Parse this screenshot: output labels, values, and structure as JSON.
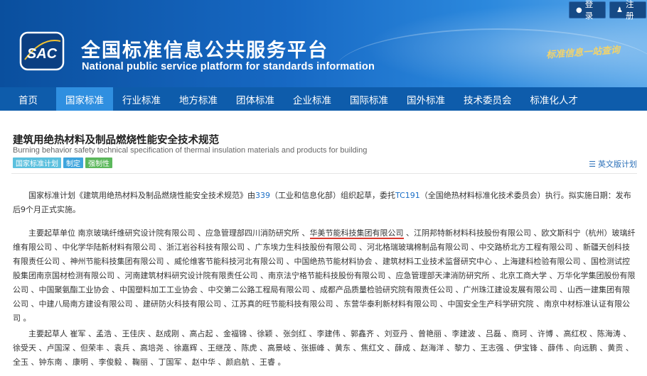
{
  "header": {
    "logo_text": "SAC",
    "title": "全国标准信息公共服务平台",
    "subtitle": "National public service platform  for standards information",
    "slogan": "标准信息一站查询",
    "login_label": "登录",
    "register_label": "注册"
  },
  "nav": {
    "items": [
      {
        "label": "首页"
      },
      {
        "label": "国家标准"
      },
      {
        "label": "行业标准"
      },
      {
        "label": "地方标准"
      },
      {
        "label": "团体标准"
      },
      {
        "label": "企业标准"
      },
      {
        "label": "国际标准"
      },
      {
        "label": "国外标准"
      },
      {
        "label": "技术委员会"
      },
      {
        "label": "标准化人才"
      }
    ],
    "active": "国家标准"
  },
  "standard": {
    "title": "建筑用绝热材料及制品燃烧性能安全技术规范",
    "title_en": "Burning behavior safety technical specification of thermal insulation materials and products for building",
    "badges": [
      "国家标准计划",
      "制定",
      "强制性"
    ],
    "english_version_label": "英文版计划"
  },
  "plan": {
    "p1": "国家标准计划《建筑用绝热材料及制品燃烧性能安全技术规范》由",
    "dept_code": "339",
    "p2": "（工业和信息化部）组织起草，委托",
    "tc_code": "TC191",
    "p3": "（全国绝热材料标准化技术委员会）执行。拟实施日期：发布后9个月正式实施。"
  },
  "units": {
    "label": "主要起草单位",
    "before": "南京玻璃纤维研究设计院有限公司 、应急管理部四川消防研究所 、",
    "highlighted": "华美节能科技集团有限公司",
    "after": " 、江阴邦特新材料科技股份有限公司 、欧文斯科宁（杭州）玻璃纤维有限公司 、中化学华陆新材料有限公司 、浙江岩谷科技有限公司 、广东埃力生科技股份有限公司 、河北格瑞玻璃棉制品有限公司 、中交路桥北方工程有限公司 、新疆天创科技有限责任公司 、神州节能科技集团有限公司 、威伦维客节能科技河北有限公司 、中国绝热节能材料协会 、建筑材料工业技术监督研究中心 、上海建科检验有限公司 、国检测试控股集团南京国材检测有限公司 、河南建筑材料研究设计院有限责任公司 、南京法宁格节能科技股份有限公司 、应急管理部天津消防研究所 、北京工商大学 、万华化学集团股份有限公司 、中国聚氨酯工业协会 、中国塑料加工工业协会 、中交第二公路工程局有限公司 、成都产品质量检验研究院有限责任公司 、广州珠江建设发展有限公司 、山西一建集团有限公司 、中建八局南方建设有限公司 、建研防火科技有限公司 、江苏真的旺节能科技有限公司 、东营华泰利新材料有限公司 、中国安全生产科学研究院 、南京中材标准认证有限公司 。"
  },
  "people": {
    "label": "主要起草人",
    "text": "崔军 、孟浩 、王佳庆 、赵成刚 、高占起 、金福锦 、徐颖 、张剑红 、李建伟 、郭鑫齐 、刘亚丹 、曾艳丽 、李建波 、吕磊 、商珂 、许博 、高红权 、陈海涛 、徐受天 、卢国深 、但荣丰 、袁兵 、高培尧 、徐嘉辉 、王继茂 、陈虎 、高景岐 、张振峰 、黄东 、焦红文 、薛成 、赵海洋 、黎力 、王志强 、伊宝锋 、薛伟 、向远鹏 、黄贡 、全玉 、钟东南 、康明 、李俊毅 、鞠丽 、丁国军 、赵中华 、颜启航 、王睿 。"
  },
  "colors": {
    "header_blue": "#0a4f9e",
    "nav_blue": "#0e5cab",
    "nav_active": "#2f8fe0",
    "link": "#1b6fc6",
    "underline": "#d9382e"
  }
}
